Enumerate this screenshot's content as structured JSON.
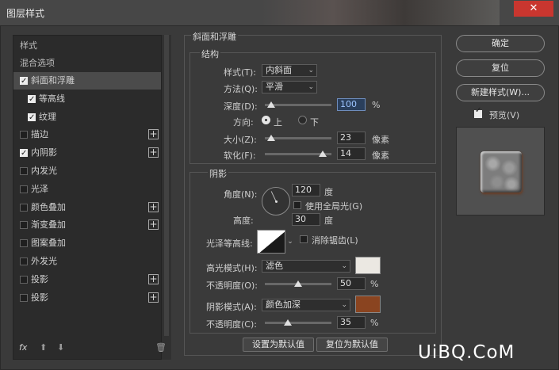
{
  "window": {
    "title": "图层样式",
    "close_label": "✕"
  },
  "left": {
    "header_style": "样式",
    "header_blend": "混合选项",
    "items": [
      {
        "label": "斜面和浮雕",
        "checked": true,
        "plus": false
      },
      {
        "label": "等高线",
        "checked": true,
        "plus": false
      },
      {
        "label": "纹理",
        "checked": true,
        "plus": false
      },
      {
        "label": "描边",
        "checked": false,
        "plus": true
      },
      {
        "label": "内阴影",
        "checked": true,
        "plus": true
      },
      {
        "label": "内发光",
        "checked": false,
        "plus": false
      },
      {
        "label": "光泽",
        "checked": false,
        "plus": false
      },
      {
        "label": "颜色叠加",
        "checked": false,
        "plus": true
      },
      {
        "label": "渐变叠加",
        "checked": false,
        "plus": true
      },
      {
        "label": "图案叠加",
        "checked": false,
        "plus": false
      },
      {
        "label": "外发光",
        "checked": false,
        "plus": false
      },
      {
        "label": "投影",
        "checked": false,
        "plus": true
      },
      {
        "label": "投影",
        "checked": false,
        "plus": true
      }
    ],
    "plus_glyph": "+",
    "footer": {
      "fx": "fx",
      "up": "⬆",
      "down": "⬇",
      "trash": "🗑"
    }
  },
  "bevel": {
    "group_title": "斜面和浮雕",
    "structure_title": "结构",
    "style_label": "样式(T):",
    "style_value": "内斜面",
    "method_label": "方法(Q):",
    "method_value": "平滑",
    "depth_label": "深度(D):",
    "depth_value": "100",
    "depth_unit": "%",
    "depth_level": 0.1,
    "direction_label": "方向:",
    "dir_up": "上",
    "dir_down": "下",
    "size_label": "大小(Z):",
    "size_value": "23",
    "size_unit": "像素",
    "size_level": 0.09,
    "soften_label": "软化(F):",
    "soften_value": "14",
    "soften_unit": "像素",
    "soften_level": 0.87
  },
  "shading": {
    "title": "阴影",
    "angle_label": "角度(N):",
    "angle_value": "120",
    "angle_unit": "度",
    "global_light_label": "使用全局光(G)",
    "altitude_label": "高度:",
    "altitude_value": "30",
    "altitude_unit": "度",
    "gloss_label": "光泽等高线:",
    "antialias_label": "消除锯齿(L)",
    "highlight_label": "高光模式(H):",
    "highlight_value": "滤色",
    "highlight_color": "#ebe8e2",
    "hl_opacity_label": "不透明度(O):",
    "hl_opacity_value": "50",
    "hl_opacity_level": 0.5,
    "shadow_label": "阴影模式(A):",
    "shadow_value": "颜色加深",
    "shadow_color": "#8a4420",
    "sh_opacity_label": "不透明度(C):",
    "sh_opacity_value": "35",
    "sh_opacity_level": 0.35,
    "pct": "%"
  },
  "buttons": {
    "set_default": "设置为默认值",
    "reset_default": "复位为默认值",
    "ok": "确定",
    "reset": "复位",
    "new_style": "新建样式(W)...",
    "preview": "预览(V)"
  },
  "watermark": "UiBQ.CoM"
}
